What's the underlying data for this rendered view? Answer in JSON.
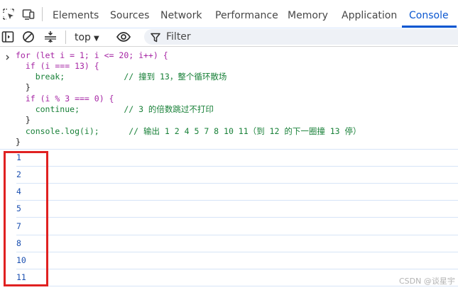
{
  "tabs": [
    {
      "label": "Elements"
    },
    {
      "label": "Sources"
    },
    {
      "label": "Network"
    },
    {
      "label": "Performance"
    },
    {
      "label": "Memory"
    },
    {
      "label": "Application"
    },
    {
      "label": "Console",
      "active": true
    }
  ],
  "toolbar": {
    "context": "top",
    "filter_placeholder": "Filter"
  },
  "code": {
    "lines": [
      "for (let i = 1; i <= 20; i++) {",
      "  if (i === 13) {",
      "    break;            // 撞到 13，整个循环散场",
      "  }",
      "  if (i % 3 === 0) {",
      "    continue;         // 3 的倍数跳过不打印",
      "  }",
      "  console.log(i);      // 输出 1 2 4 5 7 8 10 11（到 12 的下一圈撞 13 停）",
      "}"
    ]
  },
  "output": [
    "1",
    "2",
    "4",
    "5",
    "7",
    "8",
    "10",
    "11"
  ],
  "watermark": "CSDN @谈星宇",
  "colors": {
    "accent": "#0b57d0",
    "highlight_box": "#e02121",
    "comment": "#188038",
    "keyword": "#a626a4"
  },
  "icons": [
    "element-picker-icon",
    "device-toggle-icon",
    "sidebar-toggle-icon",
    "clear-console-icon",
    "filter-settings-icon",
    "eye-icon",
    "filter-icon",
    "prompt-chevron-icon"
  ]
}
